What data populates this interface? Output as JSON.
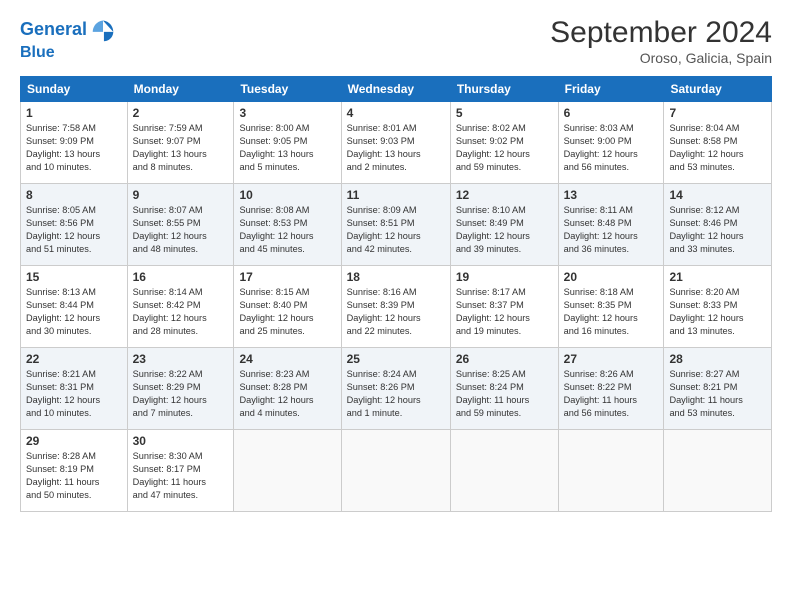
{
  "header": {
    "logo_line1": "General",
    "logo_line2": "Blue",
    "month": "September 2024",
    "location": "Oroso, Galicia, Spain"
  },
  "weekdays": [
    "Sunday",
    "Monday",
    "Tuesday",
    "Wednesday",
    "Thursday",
    "Friday",
    "Saturday"
  ],
  "weeks": [
    [
      {
        "day": "1",
        "info": "Sunrise: 7:58 AM\nSunset: 9:09 PM\nDaylight: 13 hours\nand 10 minutes."
      },
      {
        "day": "2",
        "info": "Sunrise: 7:59 AM\nSunset: 9:07 PM\nDaylight: 13 hours\nand 8 minutes."
      },
      {
        "day": "3",
        "info": "Sunrise: 8:00 AM\nSunset: 9:05 PM\nDaylight: 13 hours\nand 5 minutes."
      },
      {
        "day": "4",
        "info": "Sunrise: 8:01 AM\nSunset: 9:03 PM\nDaylight: 13 hours\nand 2 minutes."
      },
      {
        "day": "5",
        "info": "Sunrise: 8:02 AM\nSunset: 9:02 PM\nDaylight: 12 hours\nand 59 minutes."
      },
      {
        "day": "6",
        "info": "Sunrise: 8:03 AM\nSunset: 9:00 PM\nDaylight: 12 hours\nand 56 minutes."
      },
      {
        "day": "7",
        "info": "Sunrise: 8:04 AM\nSunset: 8:58 PM\nDaylight: 12 hours\nand 53 minutes."
      }
    ],
    [
      {
        "day": "8",
        "info": "Sunrise: 8:05 AM\nSunset: 8:56 PM\nDaylight: 12 hours\nand 51 minutes."
      },
      {
        "day": "9",
        "info": "Sunrise: 8:07 AM\nSunset: 8:55 PM\nDaylight: 12 hours\nand 48 minutes."
      },
      {
        "day": "10",
        "info": "Sunrise: 8:08 AM\nSunset: 8:53 PM\nDaylight: 12 hours\nand 45 minutes."
      },
      {
        "day": "11",
        "info": "Sunrise: 8:09 AM\nSunset: 8:51 PM\nDaylight: 12 hours\nand 42 minutes."
      },
      {
        "day": "12",
        "info": "Sunrise: 8:10 AM\nSunset: 8:49 PM\nDaylight: 12 hours\nand 39 minutes."
      },
      {
        "day": "13",
        "info": "Sunrise: 8:11 AM\nSunset: 8:48 PM\nDaylight: 12 hours\nand 36 minutes."
      },
      {
        "day": "14",
        "info": "Sunrise: 8:12 AM\nSunset: 8:46 PM\nDaylight: 12 hours\nand 33 minutes."
      }
    ],
    [
      {
        "day": "15",
        "info": "Sunrise: 8:13 AM\nSunset: 8:44 PM\nDaylight: 12 hours\nand 30 minutes."
      },
      {
        "day": "16",
        "info": "Sunrise: 8:14 AM\nSunset: 8:42 PM\nDaylight: 12 hours\nand 28 minutes."
      },
      {
        "day": "17",
        "info": "Sunrise: 8:15 AM\nSunset: 8:40 PM\nDaylight: 12 hours\nand 25 minutes."
      },
      {
        "day": "18",
        "info": "Sunrise: 8:16 AM\nSunset: 8:39 PM\nDaylight: 12 hours\nand 22 minutes."
      },
      {
        "day": "19",
        "info": "Sunrise: 8:17 AM\nSunset: 8:37 PM\nDaylight: 12 hours\nand 19 minutes."
      },
      {
        "day": "20",
        "info": "Sunrise: 8:18 AM\nSunset: 8:35 PM\nDaylight: 12 hours\nand 16 minutes."
      },
      {
        "day": "21",
        "info": "Sunrise: 8:20 AM\nSunset: 8:33 PM\nDaylight: 12 hours\nand 13 minutes."
      }
    ],
    [
      {
        "day": "22",
        "info": "Sunrise: 8:21 AM\nSunset: 8:31 PM\nDaylight: 12 hours\nand 10 minutes."
      },
      {
        "day": "23",
        "info": "Sunrise: 8:22 AM\nSunset: 8:29 PM\nDaylight: 12 hours\nand 7 minutes."
      },
      {
        "day": "24",
        "info": "Sunrise: 8:23 AM\nSunset: 8:28 PM\nDaylight: 12 hours\nand 4 minutes."
      },
      {
        "day": "25",
        "info": "Sunrise: 8:24 AM\nSunset: 8:26 PM\nDaylight: 12 hours\nand 1 minute."
      },
      {
        "day": "26",
        "info": "Sunrise: 8:25 AM\nSunset: 8:24 PM\nDaylight: 11 hours\nand 59 minutes."
      },
      {
        "day": "27",
        "info": "Sunrise: 8:26 AM\nSunset: 8:22 PM\nDaylight: 11 hours\nand 56 minutes."
      },
      {
        "day": "28",
        "info": "Sunrise: 8:27 AM\nSunset: 8:21 PM\nDaylight: 11 hours\nand 53 minutes."
      }
    ],
    [
      {
        "day": "29",
        "info": "Sunrise: 8:28 AM\nSunset: 8:19 PM\nDaylight: 11 hours\nand 50 minutes."
      },
      {
        "day": "30",
        "info": "Sunrise: 8:30 AM\nSunset: 8:17 PM\nDaylight: 11 hours\nand 47 minutes."
      },
      {
        "day": "",
        "info": ""
      },
      {
        "day": "",
        "info": ""
      },
      {
        "day": "",
        "info": ""
      },
      {
        "day": "",
        "info": ""
      },
      {
        "day": "",
        "info": ""
      }
    ]
  ]
}
